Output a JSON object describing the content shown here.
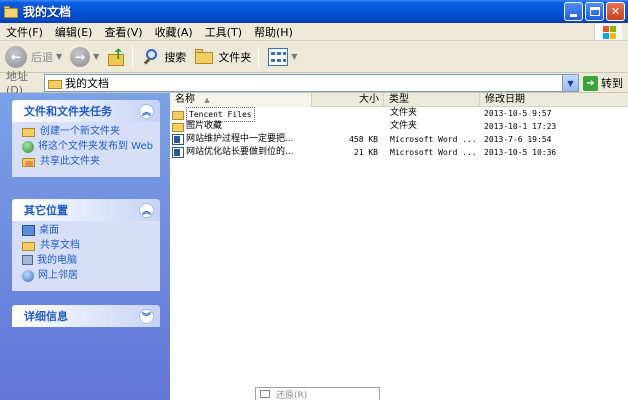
{
  "window": {
    "title": "我的文档",
    "colors": {
      "titlebar": "#0254d6",
      "taskpane": "#7ba2e7",
      "link": "#215dc6"
    }
  },
  "menubar": {
    "items": [
      "文件(F)",
      "编辑(E)",
      "查看(V)",
      "收藏(A)",
      "工具(T)",
      "帮助(H)"
    ]
  },
  "toolbar": {
    "back_label": "后退",
    "search_label": "搜索",
    "folders_label": "文件夹"
  },
  "address": {
    "label": "地址(D)",
    "value": "我的文档",
    "go_label": "转到"
  },
  "taskpane": {
    "file_tasks": {
      "title": "文件和文件夹任务",
      "items": [
        "创建一个新文件夹",
        "将这个文件夹发布到 Web",
        "共享此文件夹"
      ]
    },
    "other_places": {
      "title": "其它位置",
      "items": [
        "桌面",
        "共享文档",
        "我的电脑",
        "网上邻居"
      ]
    },
    "details": {
      "title": "详细信息"
    }
  },
  "filelist": {
    "columns": {
      "name": "名称",
      "size": "大小",
      "type": "类型",
      "modified": "修改日期"
    },
    "rows": [
      {
        "name": "Tencent Files",
        "size": "",
        "type": "文件夹",
        "modified": "2013-10-5 9:57",
        "icon": "folder-icon"
      },
      {
        "name": "图片收藏",
        "size": "",
        "type": "文件夹",
        "modified": "2013-10-1 17:23",
        "icon": "folder-icon"
      },
      {
        "name": "网站维护过程中一定要把...",
        "size": "458 KB",
        "type": "Microsoft Word ...",
        "modified": "2013-7-6 19:54",
        "icon": "word-document-icon"
      },
      {
        "name": "网站优化站长要做到位的...",
        "size": "21 KB",
        "type": "Microsoft Word ...",
        "modified": "2013-10-5 10:36",
        "icon": "word-document-icon"
      }
    ]
  },
  "popup": {
    "item": "还原(R)"
  }
}
